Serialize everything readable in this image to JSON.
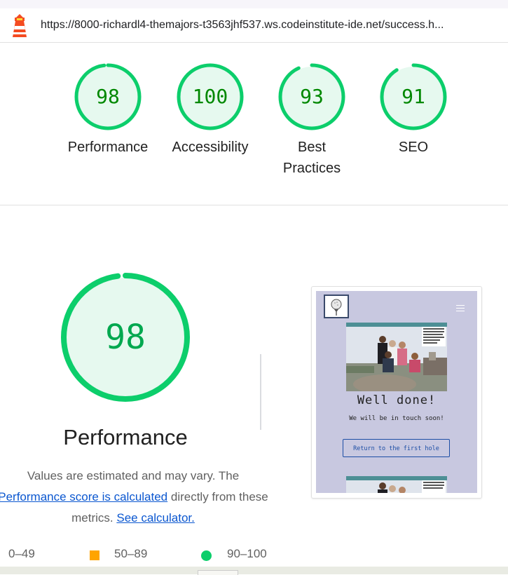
{
  "browser": {
    "url": "https://8000-richardl4-themajors-t3563jhf537.ws.codeinstitute-ide.net/success.h..."
  },
  "summary_gauges": [
    {
      "label": "Performance",
      "score": "98",
      "value": 98
    },
    {
      "label": "Accessibility",
      "score": "100",
      "value": 100
    },
    {
      "label_line1": "Best",
      "label_line2": "Practices",
      "score": "93",
      "value": 93
    },
    {
      "label": "SEO",
      "score": "91",
      "value": 91
    }
  ],
  "performance": {
    "score": "98",
    "value": 98,
    "title": "Performance",
    "desc_1": "Values are estimated and may vary. The",
    "desc_link_1": "Performance score is calculated",
    "desc_2": " directly from these",
    "desc_3": "metrics. ",
    "desc_link_2": "See calculator."
  },
  "legend": {
    "fail": "0–49",
    "average": "50–89",
    "pass": "90–100"
  },
  "thumbnail": {
    "title": "Well done!",
    "subtitle": "We will be in touch soon!",
    "button": "Return to the first hole"
  },
  "colors": {
    "pass": "#0cce6b",
    "pass_fill": "#e6f9ef",
    "pass_text": "#008800",
    "average": "#ffa400",
    "link": "#0b57d0"
  }
}
